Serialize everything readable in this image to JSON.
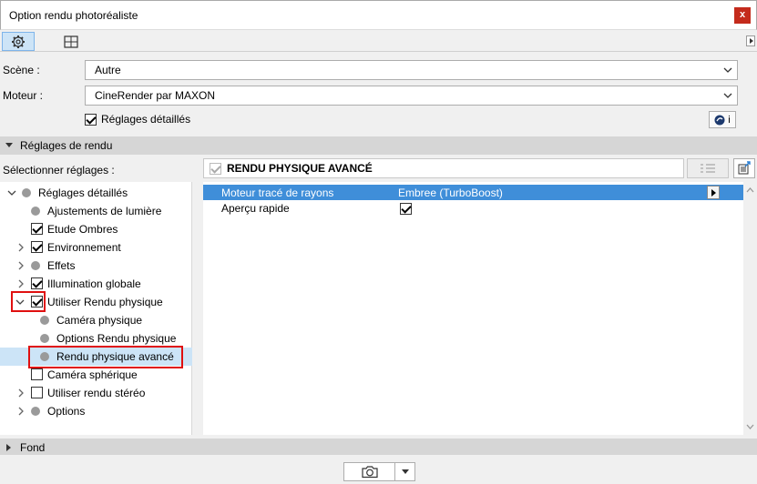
{
  "window": {
    "title": "Option rendu photoréaliste",
    "close_label": "x"
  },
  "tabs": [
    {
      "icon": "gear-icon",
      "active": true
    },
    {
      "icon": "grid-icon",
      "active": false
    }
  ],
  "scene": {
    "label": "Scène :",
    "value": "Autre"
  },
  "engine": {
    "label": "Moteur :",
    "value": "CineRender par MAXON"
  },
  "detailed_settings": {
    "label": "Réglages détaillés",
    "checked": true
  },
  "info_button": {
    "label": "i"
  },
  "render_section": {
    "label": "Réglages de rendu"
  },
  "select_settings_label": "Sélectionner réglages :",
  "tree": [
    {
      "label": "Réglages détaillés",
      "mark": "dot",
      "expander": "expanded"
    },
    {
      "label": "Ajustements de lumière",
      "mark": "dot",
      "expander": "none"
    },
    {
      "label": "Etude Ombres",
      "mark": "checked",
      "expander": "none"
    },
    {
      "label": "Environnement",
      "mark": "checked",
      "expander": "collapsed"
    },
    {
      "label": "Effets",
      "mark": "dot",
      "expander": "collapsed"
    },
    {
      "label": "Illumination globale",
      "mark": "checked",
      "expander": "collapsed"
    },
    {
      "label": "Utiliser Rendu physique",
      "mark": "checked",
      "expander": "expanded"
    },
    {
      "label": "Caméra physique",
      "mark": "dot",
      "expander": "none"
    },
    {
      "label": "Options Rendu physique",
      "mark": "dot",
      "expander": "none"
    },
    {
      "label": "Rendu physique avancé",
      "mark": "dot",
      "expander": "none",
      "selected": true
    },
    {
      "label": "Caméra sphérique",
      "mark": "unchecked",
      "expander": "none"
    },
    {
      "label": "Utiliser rendu stéréo",
      "mark": "unchecked",
      "expander": "collapsed"
    },
    {
      "label": "Options",
      "mark": "dot",
      "expander": "collapsed"
    }
  ],
  "panel": {
    "title": "RENDU PHYSIQUE AVANCÉ",
    "checked": true
  },
  "params": [
    {
      "name": "Moteur tracé de rayons",
      "value": "Embree (TurboBoost)",
      "selected": true
    },
    {
      "name": "Aperçu rapide",
      "checkbox": true
    }
  ],
  "background_section": {
    "label": "Fond"
  },
  "colors": {
    "accent": "#3f8ed9",
    "selection": "#cce4f7",
    "highlight_box": "#e01010",
    "close": "#c42b1c"
  }
}
